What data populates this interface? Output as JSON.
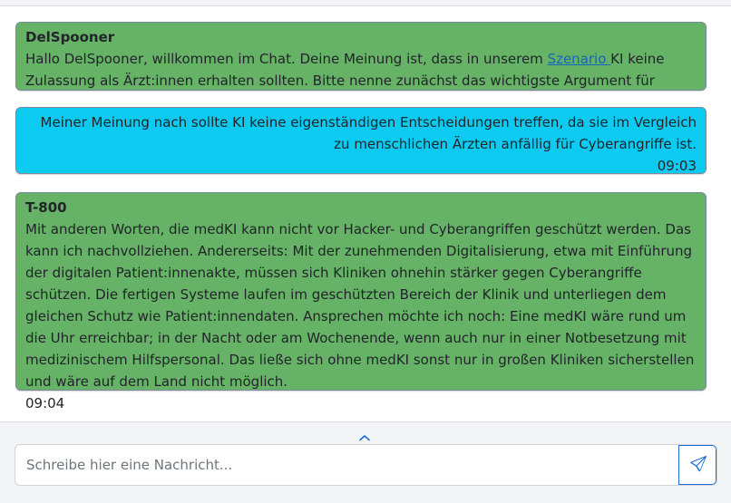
{
  "messages": [
    {
      "sender": "DelSpooner",
      "text_before_link": "Hallo DelSpooner, willkommen im Chat. Deine Meinung ist, dass in unserem ",
      "link_text": "Szenario ",
      "text_after_link": "KI keine Zulassung als Ärzt:innen erhalten sollten. Bitte nenne zunächst das wichtigste Argument für deine Meinung."
    },
    {
      "text": "Meiner Meinung nach sollte KI keine eigenständigen Entscheidungen treffen, da sie im Vergleich zu menschlichen Ärzten anfällig für Cyberangriffe ist.",
      "time": "09:03"
    },
    {
      "sender": "T-800",
      "text": "Mit anderen Worten, die medKI kann nicht vor Hacker- und Cyberangriffen geschützt werden. Das kann ich nachvollziehen. Andererseits: Mit der zunehmenden Digitalisierung, etwa mit Einführung der digitalen Patient:innenakte, müssen sich Kliniken ohnehin stärker gegen Cyberangriffe schützen. Die fertigen Systeme laufen im geschützten Bereich der Klinik und unterliegen dem gleichen Schutz wie Patient:innendaten. Ansprechen möchte ich noch: Eine medKI wäre rund um die Uhr erreichbar; in der Nacht oder am Wochenende, wenn auch nur in einer Notbesetzung mit medizinischem Hilfspersonal. Das ließe sich ohne medKI sonst nur in großen Kliniken sicherstellen und wäre auf dem Land nicht möglich.",
      "time": "09:04"
    }
  ],
  "composer": {
    "placeholder": "Schreibe hier eine Nachricht...",
    "value": ""
  },
  "icons": {
    "expand": "chevron-up-icon",
    "send": "paper-plane-icon"
  },
  "colors": {
    "bot_bubble": "#66b266",
    "user_bubble": "#0dcaf0",
    "link": "#1565c0",
    "send_icon": "#1f6fd6"
  }
}
